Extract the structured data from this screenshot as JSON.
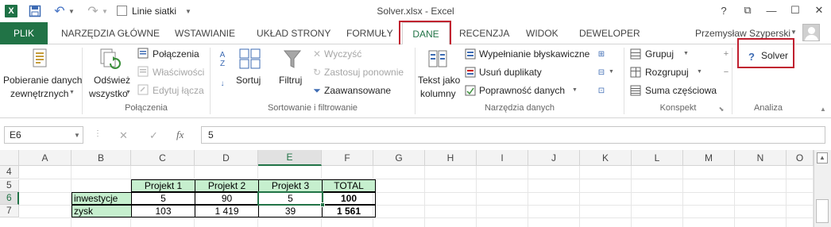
{
  "window": {
    "title": "Solver.xlsx - Excel",
    "app_icon": "X",
    "help": "?",
    "restore": "⧉",
    "minimize": "—",
    "maximize": "☐",
    "close": "✕"
  },
  "qat": {
    "gridlines_label": "Linie siatki"
  },
  "tabs": {
    "file": "PLIK",
    "home": "NARZĘDZIA GŁÓWNE",
    "insert": "WSTAWIANIE",
    "layout": "UKŁAD STRONY",
    "formulas": "FORMUŁY",
    "data": "DANE",
    "review": "RECENZJA",
    "view": "WIDOK",
    "developer": "DEWELOPER"
  },
  "user": {
    "name": "Przemysław Szyperski"
  },
  "ribbon": {
    "get_external": {
      "label_1": "Pobieranie danych",
      "label_2": "zewnętrznych"
    },
    "connections": {
      "refresh_1": "Odśwież",
      "refresh_2": "wszystko",
      "connections": "Połączenia",
      "properties": "Właściwości",
      "edit_links": "Edytuj łącza",
      "group": "Połączenia"
    },
    "sort_filter": {
      "sort_az_top": "A",
      "sort_az_bot": "Z",
      "sort": "Sortuj",
      "filter": "Filtruj",
      "clear": "Wyczyść",
      "reapply": "Zastosuj ponownie",
      "advanced": "Zaawansowane",
      "group": "Sortowanie i filtrowanie"
    },
    "data_tools": {
      "text_to_columns_1": "Tekst jako",
      "text_to_columns_2": "kolumny",
      "flash_fill": "Wypełnianie błyskawiczne",
      "remove_duplicates": "Usuń duplikaty",
      "validation": "Poprawność danych",
      "group": "Narzędzia danych"
    },
    "outline": {
      "group_btn": "Grupuj",
      "ungroup_btn": "Rozgrupuj",
      "subtotal": "Suma częściowa",
      "group": "Konspekt"
    },
    "analysis": {
      "solver": "Solver",
      "group": "Analiza"
    }
  },
  "formula_bar": {
    "name_box": "E6",
    "dots": "⋮",
    "cancel": "✕",
    "enter": "✓",
    "fx": "fx",
    "value": "5"
  },
  "grid": {
    "columns": [
      "A",
      "B",
      "C",
      "D",
      "E",
      "F",
      "G",
      "H",
      "I",
      "J",
      "K",
      "L",
      "M",
      "N",
      "O"
    ],
    "rows": [
      "4",
      "5",
      "6",
      "7"
    ],
    "selected_col": "E",
    "selected_row": "6",
    "table": {
      "headers": [
        "Projekt 1",
        "Projekt 2",
        "Projekt 3",
        "TOTAL"
      ],
      "row1": {
        "label": "inwestycje",
        "values": [
          "5",
          "90",
          "5"
        ],
        "total": "100"
      },
      "row2": {
        "label": "zysk",
        "values": [
          "103",
          "1 419",
          "39"
        ],
        "total": "1 561"
      }
    }
  }
}
